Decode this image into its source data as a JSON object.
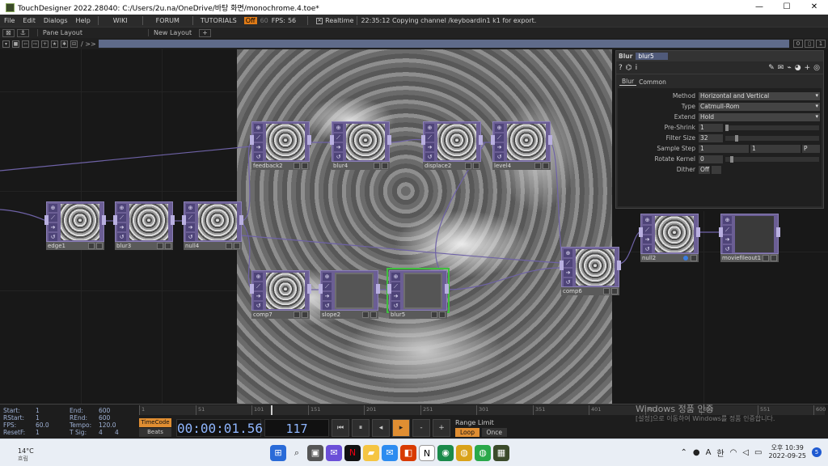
{
  "window": {
    "title": "TouchDesigner 2022.28040: C:/Users/2u.na/OneDrive/바탕 화면/monochrome.4.toe*",
    "min": "—",
    "max": "☐",
    "close": "✕"
  },
  "menu": {
    "items": [
      "File",
      "Edit",
      "Dialogs",
      "Help"
    ],
    "wiki": "WIKI",
    "forum": "FORUM",
    "tutorials": "TUTORIALS",
    "perf_badge": "Off",
    "fps_dim": "60",
    "fps_label": "FPS:",
    "fps_value": "56",
    "realtime": "Realtime",
    "status": "22:35:12 Copying channel /keyboardin1 k1 for export."
  },
  "panebar": {
    "pane_layout": "Pane Layout",
    "new_layout": "New Layout",
    "add": "+"
  },
  "pathbar": {
    "path": "/ >>",
    "num_left": "0",
    "num_right": "1"
  },
  "nodes": [
    {
      "id": "edge1",
      "label": "edge1"
    },
    {
      "id": "blur3",
      "label": "blur3"
    },
    {
      "id": "null4",
      "label": "null4"
    },
    {
      "id": "feedback2",
      "label": "feedback2"
    },
    {
      "id": "blur4",
      "label": "blur4"
    },
    {
      "id": "displace2",
      "label": "displace2"
    },
    {
      "id": "level4",
      "label": "level4"
    },
    {
      "id": "comp7",
      "label": "comp7"
    },
    {
      "id": "slope2",
      "label": "slope2"
    },
    {
      "id": "blur5",
      "label": "blur5"
    },
    {
      "id": "comp6",
      "label": "comp6"
    },
    {
      "id": "null2",
      "label": "null2"
    },
    {
      "id": "moviefileout1",
      "label": "moviefileout1"
    }
  ],
  "params": {
    "op_type": "Blur",
    "op_name": "blur5",
    "tabs": [
      "Blur",
      "Common"
    ],
    "rows": [
      {
        "label": "Method",
        "value": "Horizontal and Vertical",
        "kind": "menu"
      },
      {
        "label": "Type",
        "value": "Catmull-Rom",
        "kind": "menu"
      },
      {
        "label": "Extend",
        "value": "Hold",
        "kind": "menu"
      },
      {
        "label": "Pre-Shrink",
        "value": "1",
        "kind": "slider"
      },
      {
        "label": "Filter Size",
        "value": "32",
        "kind": "slider"
      },
      {
        "label": "Sample Step",
        "value": "1",
        "value2": "1",
        "value3": "P",
        "kind": "triple"
      },
      {
        "label": "Rotate Kernel",
        "value": "0",
        "kind": "slider"
      },
      {
        "label": "Dither",
        "value": "Off",
        "kind": "toggle"
      }
    ]
  },
  "stats": {
    "start_l": "Start:",
    "start_v": "1",
    "rstart_l": "RStart:",
    "rstart_v": "1",
    "fps_l": "FPS:",
    "fps_v": "60.0",
    "resetf_l": "ResetF:",
    "resetf_v": "1",
    "end_l": "End:",
    "end_v": "600",
    "rend_l": "REnd:",
    "rend_v": "600",
    "tempo_l": "Tempo:",
    "tempo_v": "120.0",
    "tsig_l": "T Sig:",
    "tsig_v1": "4",
    "tsig_v2": "4"
  },
  "timeline": {
    "ticks": [
      "1",
      "51",
      "101",
      "151",
      "201",
      "251",
      "301",
      "351",
      "401",
      "451",
      "501",
      "551",
      "600"
    ]
  },
  "transport": {
    "timecode": "TimeCode",
    "beats": "Beats",
    "clock": "00:00:01.56",
    "frame": "117",
    "range_label": "Range Limit",
    "loop": "Loop",
    "once": "Once",
    "minus": "-",
    "plus": "+"
  },
  "watermark": {
    "line1": "Windows 정품 인증",
    "line2": "[설정]으로 이동하여 Windows를 정품 인증합니다."
  },
  "taskbar": {
    "temp": "14°C",
    "weather": "흐림",
    "ime1": "A",
    "ime2": "한",
    "time": "오후 10:39",
    "date": "2022-09-25",
    "notif": "5"
  }
}
